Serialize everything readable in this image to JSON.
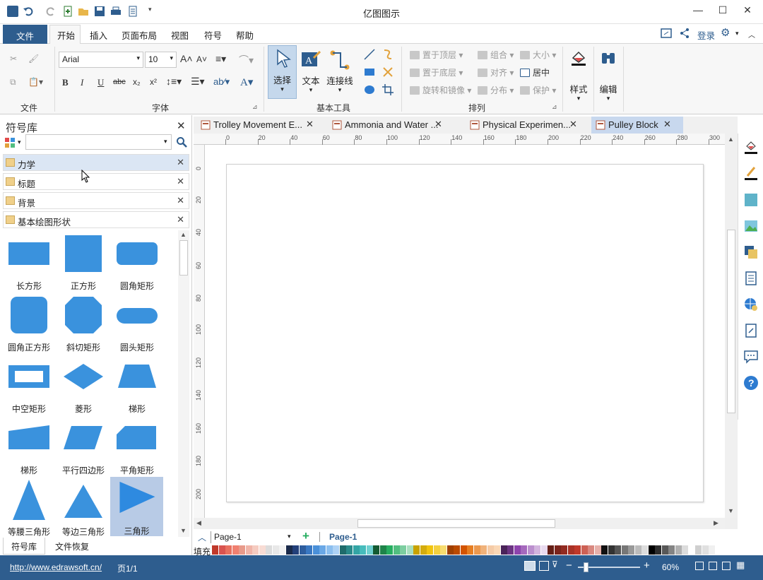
{
  "window": {
    "title": "亿图图示"
  },
  "menu": {
    "file": "文件",
    "tabs": [
      "开始",
      "插入",
      "页面布局",
      "视图",
      "符号",
      "帮助"
    ],
    "login": "登录"
  },
  "ribbon": {
    "groups": [
      "文件",
      "字体",
      "基本工具",
      "排列",
      "样式",
      "编辑"
    ],
    "font_name": "Arial",
    "font_size": "10",
    "tools": {
      "select": "选择",
      "text": "文本",
      "connector": "连接线"
    },
    "arrange": {
      "bring_front": "置于顶层",
      "send_back": "置于底层",
      "rotate": "旋转和镜像",
      "group": "组合",
      "align": "对齐",
      "distribute": "分布",
      "size": "大小",
      "center": "居中",
      "protect": "保护"
    },
    "style_label": "样式",
    "edit_label": "编辑"
  },
  "library": {
    "title": "符号库",
    "search_placeholder": "",
    "sections": [
      "力学",
      "标题",
      "背景",
      "基本绘图形状"
    ],
    "shapes": [
      "长方形",
      "正方形",
      "圆角矩形",
      "圆角正方形",
      "斜切矩形",
      "圆头矩形",
      "中空矩形",
      "菱形",
      "梯形",
      "梯形",
      "平行四边形",
      "平角矩形",
      "等腰三角形",
      "等边三角形",
      "三角形"
    ],
    "bottom_tabs": [
      "符号库",
      "文件恢复"
    ]
  },
  "doc_tabs": [
    "Trolley Movement E...",
    "Ammonia and Water ...",
    "Physical Experimen...",
    "Pulley Block"
  ],
  "ruler": {
    "h": [
      "0",
      "20",
      "40",
      "60",
      "80",
      "100",
      "120",
      "140",
      "160",
      "180",
      "200",
      "220",
      "240",
      "260",
      "280",
      "300"
    ],
    "v": [
      "0",
      "20",
      "40",
      "60",
      "80",
      "100",
      "120",
      "140",
      "160",
      "180",
      "200"
    ]
  },
  "pages": {
    "selector": "Page-1",
    "active": "Page-1"
  },
  "palette": {
    "label": "填充",
    "colors": [
      "#c0392b",
      "#d9534f",
      "#e8705f",
      "#f08070",
      "#e89a8a",
      "#f0b4a8",
      "#f5cbc0",
      "#f8dcd4",
      "#dcdcdc",
      "#e8e8e8",
      "#f2f2f2",
      "#1a2a4a",
      "#23407a",
      "#2e5d9e",
      "#3a78c2",
      "#4a90d9",
      "#6aa8e6",
      "#8cbfef",
      "#aed2f5",
      "#1f6b6b",
      "#2a8a8a",
      "#34a5a5",
      "#47bcbc",
      "#6fd0d0",
      "#145a32",
      "#1e8449",
      "#27ae60",
      "#52be80",
      "#7dcea0",
      "#a9dfbf",
      "#c9a200",
      "#d4ac0d",
      "#f1c40f",
      "#f4d03f",
      "#f7dc6f",
      "#a04000",
      "#ba4a00",
      "#d35400",
      "#e67e22",
      "#eb984e",
      "#f0b27a",
      "#f5cba7",
      "#fad7b5",
      "#4a235a",
      "#6c3483",
      "#8e44ad",
      "#a569bd",
      "#bb8fce",
      "#d2b4de",
      "#e8daef",
      "#641e16",
      "#7b241c",
      "#922b21",
      "#a93226",
      "#c0392b",
      "#cd6155",
      "#d98880",
      "#e6b0aa",
      "#111111",
      "#333333",
      "#555555",
      "#777777",
      "#999999",
      "#bbbbbb",
      "#dddddd",
      "#000000",
      "#2c2c2c",
      "#585858",
      "#848484",
      "#b0b0b0",
      "#dcdcdc",
      "#ffffff",
      "#cfcfcf",
      "#e0e0e0",
      "#f0f0f0"
    ]
  },
  "status": {
    "url": "http://www.edrawsoft.cn/",
    "page": "页1/1",
    "zoom": "60%"
  }
}
